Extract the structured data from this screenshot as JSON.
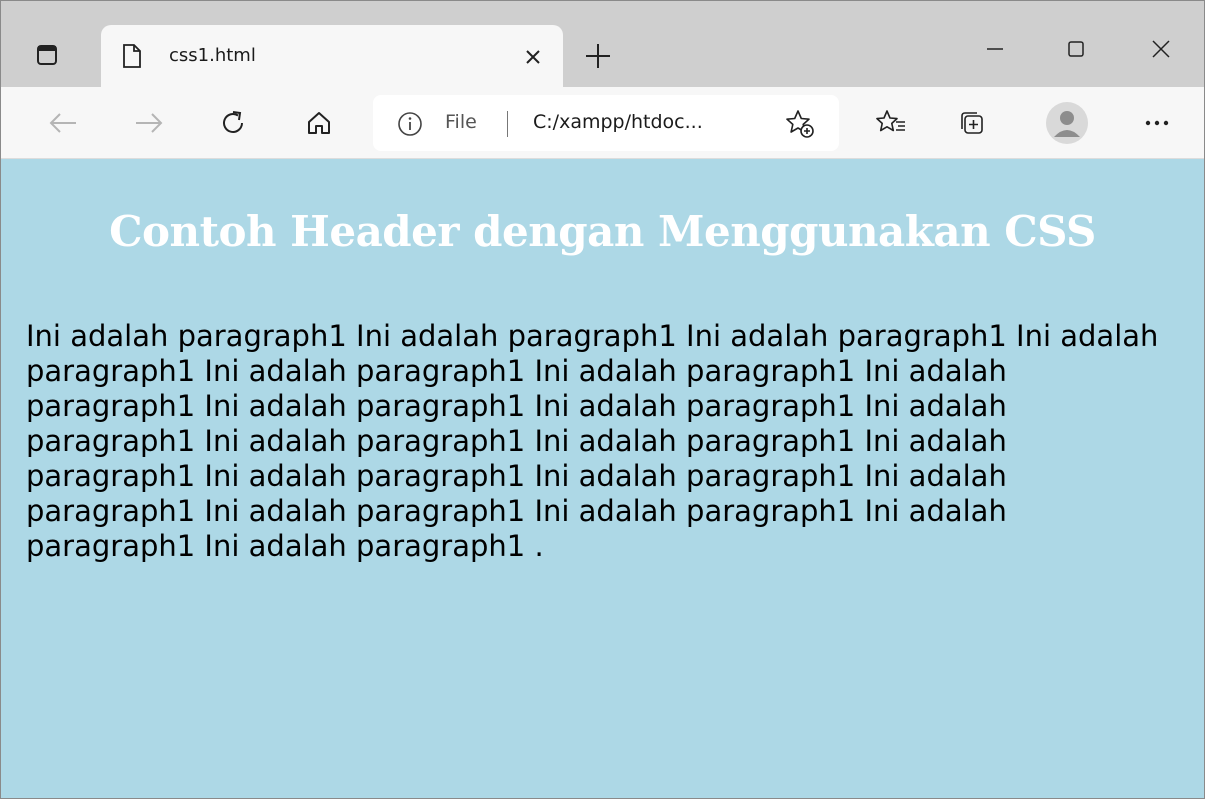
{
  "browser": {
    "tab_title": "css1.html",
    "address": {
      "scheme_label": "File",
      "url": "C:/xampp/htdoc..."
    },
    "icons": {
      "tab_actions": "tab-actions-icon",
      "tab_doc": "document-icon",
      "tab_close": "close-icon",
      "new_tab": "plus-icon",
      "minimize": "minimize-icon",
      "maximize": "maximize-icon",
      "close_window": "close-icon",
      "back": "back-arrow-icon",
      "forward": "forward-arrow-icon",
      "refresh": "refresh-icon",
      "home": "home-icon",
      "info": "info-icon",
      "add_favorite": "add-favorite-icon",
      "favorites": "favorites-icon",
      "collections": "collections-icon",
      "profile": "profile-avatar-icon",
      "more": "more-icon"
    }
  },
  "page": {
    "header": "Contoh Header dengan Menggunakan CSS",
    "paragraph": "Ini adalah paragraph1 Ini adalah paragraph1 Ini adalah paragraph1 Ini adalah paragraph1 Ini adalah paragraph1 Ini adalah paragraph1 Ini adalah paragraph1 Ini adalah paragraph1 Ini adalah paragraph1 Ini adalah paragraph1 Ini adalah paragraph1 Ini adalah paragraph1 Ini adalah paragraph1 Ini adalah paragraph1 Ini adalah paragraph1 Ini adalah paragraph1 Ini adalah paragraph1 Ini adalah paragraph1 Ini adalah paragraph1 Ini adalah paragraph1 .",
    "background_color": "#add8e6",
    "header_color": "#ffffff"
  }
}
